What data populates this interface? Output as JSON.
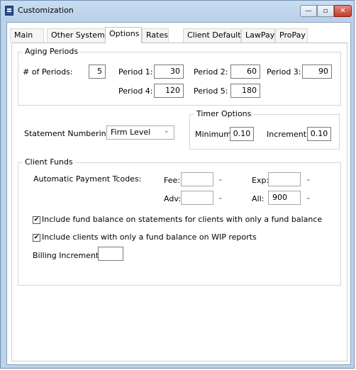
{
  "window": {
    "title": "Customization",
    "controls": {
      "minimize": "—",
      "maximize": "▫",
      "close": "✕"
    }
  },
  "tabs": [
    "Main",
    "Other Systems",
    "Options",
    "Rates",
    "Client Defaults",
    "LawPay",
    "ProPay"
  ],
  "active_tab": "Options",
  "aging": {
    "legend": "Aging Periods",
    "num_periods_label": "# of Periods:",
    "num_periods": "5",
    "period1_label": "Period 1:",
    "period1": "30",
    "period2_label": "Period 2:",
    "period2": "60",
    "period3_label": "Period 3:",
    "period3": "90",
    "period4_label": "Period 4:",
    "period4": "120",
    "period5_label": "Period 5:",
    "period5": "180"
  },
  "timer": {
    "legend": "Timer Options",
    "minimum_label": "Minimum:",
    "minimum": "0.10",
    "increment_label": "Increment:",
    "increment": "0.10"
  },
  "statement": {
    "label": "Statement Numbering:",
    "value": "Firm Level"
  },
  "funds": {
    "legend": "Client Funds",
    "auto_label": "Automatic Payment Tcodes:",
    "fee_label": "Fee:",
    "fee_value": "",
    "exp_label": "Exp:",
    "exp_value": "",
    "adv_label": "Adv:",
    "adv_value": "",
    "all_label": "All:",
    "all_value": "900",
    "check1_label": "Include fund balance on statements for clients with only a fund balance",
    "check1_checked": true,
    "check2_label": "Include clients with only a fund balance on WIP reports",
    "check2_checked": true,
    "billing_label": "Billing Increment:",
    "billing_value": ""
  },
  "icons": {
    "app": "ledger-icon",
    "chevron": "⌄",
    "check": "✔"
  }
}
